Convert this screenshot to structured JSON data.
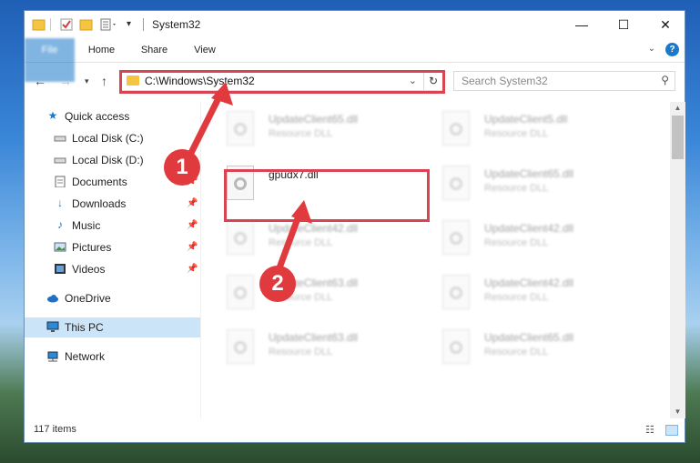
{
  "window": {
    "title": "System32",
    "controls": {
      "minimize": "—",
      "maximize": "☐",
      "close": "✕"
    }
  },
  "ribbon": {
    "tabs": [
      "File",
      "Home",
      "Share",
      "View"
    ],
    "help": "?"
  },
  "nav": {
    "address": "C:\\Windows\\System32",
    "search_placeholder": "Search System32"
  },
  "sidebar": {
    "items": [
      {
        "label": "Quick access",
        "icon": "star-icon"
      },
      {
        "label": "Local Disk (C:)",
        "icon": "drive-icon"
      },
      {
        "label": "Local Disk (D:)",
        "icon": "drive-icon"
      },
      {
        "label": "Documents",
        "icon": "documents-icon",
        "pinned": true
      },
      {
        "label": "Downloads",
        "icon": "download-icon",
        "pinned": true
      },
      {
        "label": "Music",
        "icon": "music-icon",
        "pinned": true
      },
      {
        "label": "Pictures",
        "icon": "pictures-icon",
        "pinned": true
      },
      {
        "label": "Videos",
        "icon": "videos-icon",
        "pinned": true
      },
      {
        "label": "OneDrive",
        "icon": "cloud-icon"
      },
      {
        "label": "This PC",
        "icon": "computer-icon",
        "selected": true
      },
      {
        "label": "Network",
        "icon": "network-icon"
      }
    ]
  },
  "files": [
    {
      "name": "UpdateClient65.dll",
      "type": "Resource DLL"
    },
    {
      "name": "UpdateClient5.dll",
      "type": "Resource DLL"
    },
    {
      "name": "gpudx7.dll",
      "type": ""
    },
    {
      "name": "UpdateClient65.dll",
      "type": "Resource DLL"
    },
    {
      "name": "UpdateClient42.dll",
      "type": "Resource DLL"
    },
    {
      "name": "UpdateClient42.dll",
      "type": "Resource DLL"
    },
    {
      "name": "UpdateClient63.dll",
      "type": "Resource DLL"
    },
    {
      "name": "UpdateClient42.dll",
      "type": "Resource DLL"
    },
    {
      "name": "UpdateClient63.dll",
      "type": "Resource DLL"
    },
    {
      "name": "UpdateClient65.dll",
      "type": "Resource DLL"
    }
  ],
  "status": {
    "count": "117 items"
  },
  "callouts": {
    "one": "1",
    "two": "2"
  },
  "colors": {
    "accent": "#1979ca",
    "highlight": "#d94452",
    "callout": "#e0393e",
    "selected": "#cce4f7"
  }
}
